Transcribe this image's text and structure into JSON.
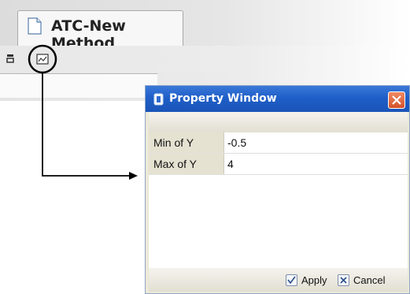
{
  "document_tab": {
    "label": "ATC-New Method",
    "icon": "document-icon"
  },
  "toolbar": {
    "icons": [
      "view-toggle-icon",
      "chart-properties-icon"
    ]
  },
  "property_window": {
    "title": "Property Window",
    "title_icon": "property-window-icon",
    "rows": [
      {
        "key": "Min of Y",
        "value": "-0.5"
      },
      {
        "key": "Max of Y",
        "value": "4"
      }
    ],
    "apply_label": "Apply",
    "cancel_label": "Cancel",
    "colors": {
      "titlebar": "#1f5fc8",
      "close_button": "#d5522a"
    }
  }
}
